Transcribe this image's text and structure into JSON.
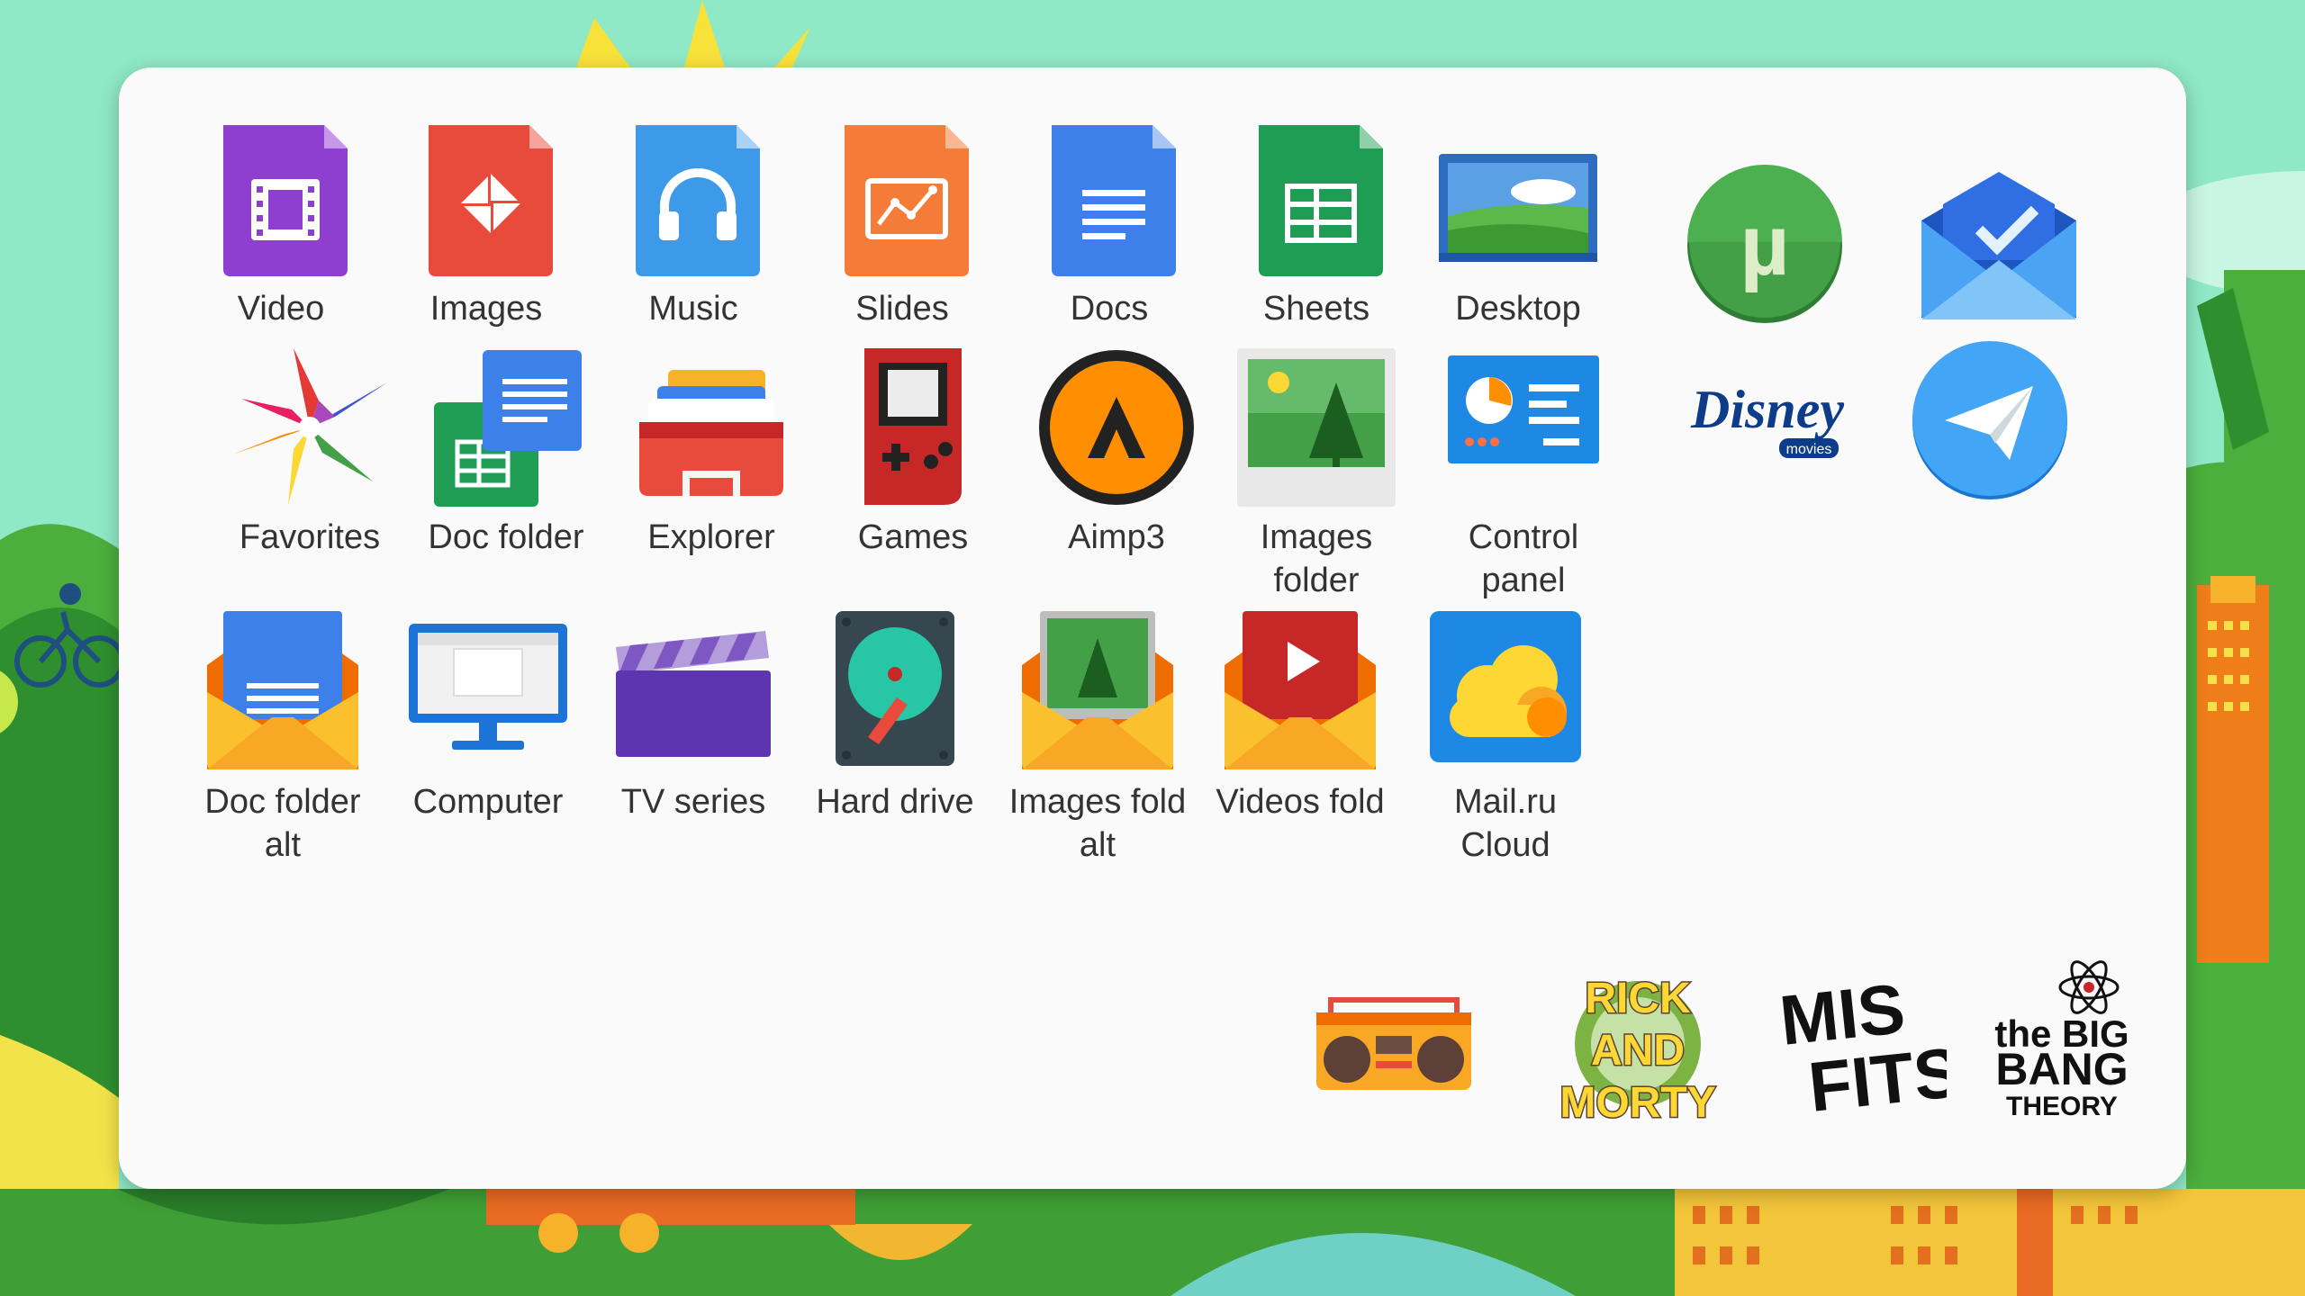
{
  "colors": {
    "panel_bg": "#fafafa",
    "label_text": "#333333",
    "wallpaper_sky": "#8fe8c6",
    "wallpaper_grass": "#4cae3c"
  },
  "launcher": {
    "apps": [
      {
        "label": "Video",
        "icon": "video-file-icon"
      },
      {
        "label": "Images",
        "icon": "images-file-icon"
      },
      {
        "label": "Music",
        "icon": "music-file-icon"
      },
      {
        "label": "Slides",
        "icon": "slides-file-icon"
      },
      {
        "label": "Docs",
        "icon": "docs-file-icon"
      },
      {
        "label": "Sheets",
        "icon": "sheets-file-icon"
      },
      {
        "label": "Desktop",
        "icon": "desktop-wallpaper-icon"
      },
      {
        "label": "Favorites",
        "icon": "pinwheel-star-icon"
      },
      {
        "label": "Doc folder",
        "icon": "doc-folder-icon"
      },
      {
        "label": "Explorer",
        "icon": "file-explorer-icon"
      },
      {
        "label": "Games",
        "icon": "gameboy-icon"
      },
      {
        "label": "Aimp3",
        "icon": "aimp-player-icon"
      },
      {
        "label": "Images folder",
        "icon": "images-folder-icon"
      },
      {
        "label": "Control panel",
        "icon": "control-panel-icon"
      },
      {
        "label": "Doc folder alt",
        "icon": "doc-envelope-icon"
      },
      {
        "label": "Computer",
        "icon": "computer-monitor-icon"
      },
      {
        "label": "TV series",
        "icon": "clapperboard-icon"
      },
      {
        "label": "Hard drive",
        "icon": "hard-drive-icon"
      },
      {
        "label": "Images fold alt",
        "icon": "images-envelope-icon"
      },
      {
        "label": "Videos fold",
        "icon": "videos-envelope-icon"
      },
      {
        "label": "Mail.ru Cloud",
        "icon": "cloud-icon"
      }
    ],
    "shortcuts": [
      {
        "icon": "utorrent-icon",
        "text": "µ"
      },
      {
        "icon": "inbox-envelope-icon",
        "text": ""
      },
      {
        "icon": "disney-movies-logo",
        "text": "Disney",
        "sub": "movies"
      },
      {
        "icon": "telegram-icon",
        "text": ""
      }
    ],
    "shows": [
      {
        "icon": "boombox-icon",
        "text": ""
      },
      {
        "icon": "rick-and-morty-logo",
        "lines": [
          "RICK",
          "AND",
          "MORTY"
        ]
      },
      {
        "icon": "misfits-logo",
        "lines": [
          "MIS",
          "FITS"
        ]
      },
      {
        "icon": "big-bang-theory-logo",
        "lines": [
          "the BIG",
          "BANG",
          "THEORY"
        ]
      }
    ]
  }
}
